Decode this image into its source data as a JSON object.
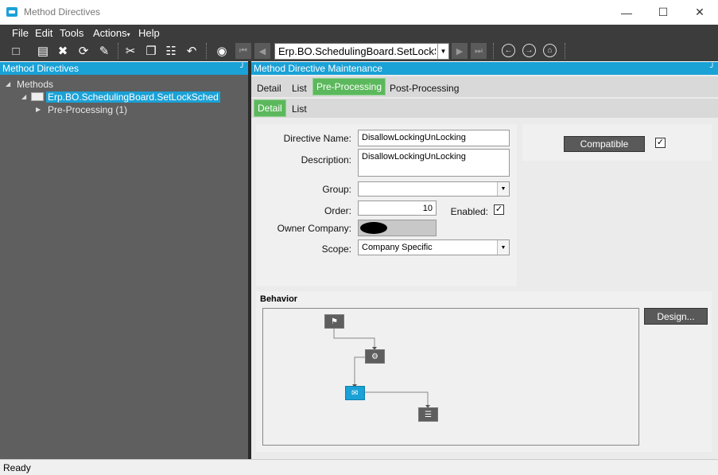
{
  "window": {
    "title": "Method Directives",
    "controls": [
      "minimize",
      "maximize",
      "close"
    ]
  },
  "menu": [
    "File",
    "Edit",
    "Tools",
    "Actions",
    "Help"
  ],
  "toolbar": {
    "method_combo": "Erp.BO.SchedulingBoard.SetLockSc"
  },
  "left_panel": {
    "header": "Method Directives",
    "tree": {
      "root": "Methods",
      "method": "Erp.BO.SchedulingBoard.SetLockSched",
      "child": "Pre-Processing (1)"
    }
  },
  "right_panel": {
    "header": "Method Directive Maintenance",
    "tabs": [
      "Detail",
      "List",
      "Pre-Processing",
      "Post-Processing"
    ],
    "active_tab": "Pre-Processing",
    "subtabs": [
      "Detail",
      "List"
    ],
    "active_subtab": "Detail",
    "form": {
      "directive_name_label": "Directive Name:",
      "directive_name": "DisallowLockingUnLocking",
      "description_label": "Description:",
      "description": "DisallowLockingUnLocking",
      "group_label": "Group:",
      "group": "",
      "order_label": "Order:",
      "order": "10",
      "enabled_label": "Enabled:",
      "enabled": true,
      "owner_company_label": "Owner Company:",
      "scope_label": "Scope:",
      "scope": "Company Specific"
    },
    "compatible_button": "Compatible",
    "compatible_checked": true,
    "behavior_label": "Behavior",
    "design_button": "Design..."
  },
  "status": "Ready",
  "colors": {
    "accent": "#1aa1d6",
    "active_tab": "#5cb85c",
    "toolbar": "#3c3c3c"
  }
}
